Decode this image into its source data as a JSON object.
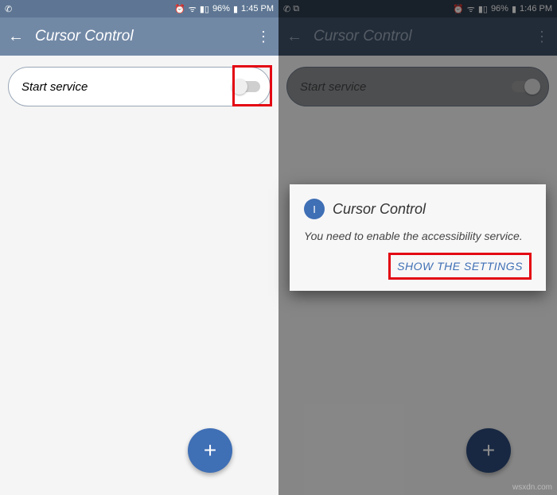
{
  "left": {
    "statusbar": {
      "battery": "96%",
      "time": "1:45 PM"
    },
    "appbar": {
      "title": "Cursor Control"
    },
    "card": {
      "label": "Start service"
    },
    "fab": {
      "glyph": "+"
    }
  },
  "right": {
    "statusbar": {
      "battery": "96%",
      "time": "1:46 PM"
    },
    "appbar": {
      "title": "Cursor Control"
    },
    "card": {
      "label": "Start service"
    },
    "fab": {
      "glyph": "+"
    },
    "dialog": {
      "avatar_letter": "I",
      "title": "Cursor Control",
      "message": "You need to enable the accessibility service.",
      "button": "SHOW THE SETTINGS"
    }
  },
  "watermark": "wsxdn.com"
}
